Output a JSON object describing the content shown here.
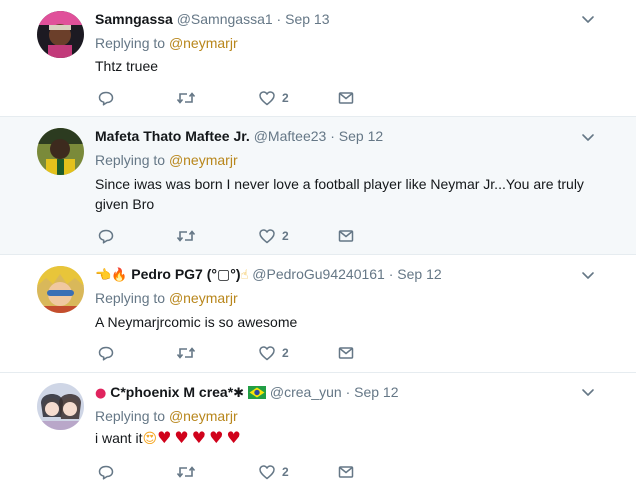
{
  "colors": {
    "link": "#b8861b",
    "muted": "#657786",
    "divider": "#e6ecf0",
    "highlight_bg": "#f5f8fa",
    "heart": "#d0021b"
  },
  "replying_label": "Replying to",
  "tweets": [
    {
      "name": "Samngassa",
      "handle": "@Samngassa1",
      "dot": "·",
      "date": "Sep 13",
      "reply_to": "@neymarjr",
      "text": "Thtz truee",
      "likes": "2"
    },
    {
      "name": "Mafeta Thato Maftee Jr.",
      "handle": "@Maftee23",
      "dot": "·",
      "date": "Sep 12",
      "reply_to": "@neymarjr",
      "text": "Since iwas was born I never love a football player like Neymar Jr...You are truly given Bro",
      "likes": "2"
    },
    {
      "name_prefix": "👈🔥",
      "name": "Pedro PG7 (°▢°)",
      "name_suffix": "☝",
      "handle": "@PedroGu94240161",
      "dot": "·",
      "date": "Sep 12",
      "reply_to": "@neymarjr",
      "text": "A Neymarjrcomic is so awesome",
      "likes": "2"
    },
    {
      "name_prefix": "●",
      "name": "C*phoenix M crea*",
      "name_suffix": "✱",
      "handle": "@crea_yun",
      "dot": "·",
      "date": "Sep 12",
      "reply_to": "@neymarjr",
      "text": "i want it",
      "text_emoji_face": "😍",
      "text_emoji_hearts": "♥♥♥♥♥",
      "likes": "2"
    }
  ]
}
